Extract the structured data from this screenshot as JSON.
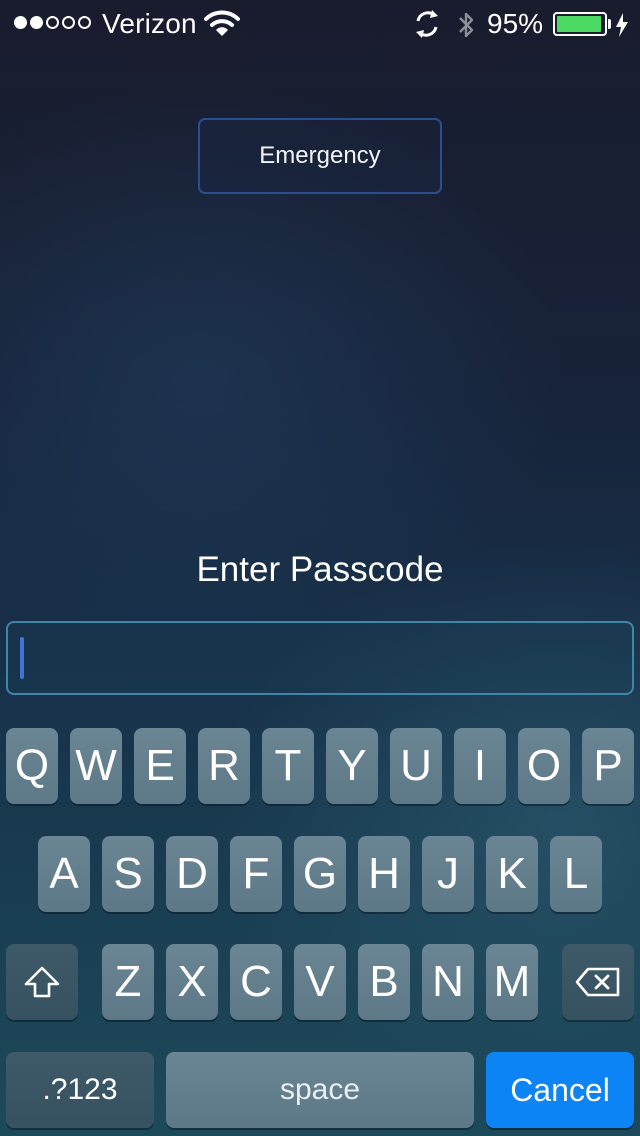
{
  "status_bar": {
    "carrier": "Verizon",
    "signal_strength_of_5": 2,
    "battery_percent_text": "95%",
    "battery_level": 0.95,
    "battery_color": "#4cd964",
    "icons": [
      "wifi-icon",
      "sync-icon",
      "bluetooth-icon",
      "battery-icon",
      "charging-bolt-icon"
    ]
  },
  "emergency_label": "Emergency",
  "prompt": "Enter Passcode",
  "passcode_field": {
    "value": "",
    "cursor_color": "#3d74d6"
  },
  "keyboard": {
    "row1": [
      "Q",
      "W",
      "E",
      "R",
      "T",
      "Y",
      "U",
      "I",
      "O",
      "P"
    ],
    "row2": [
      "A",
      "S",
      "D",
      "F",
      "G",
      "H",
      "J",
      "K",
      "L"
    ],
    "row3": [
      "Z",
      "X",
      "C",
      "V",
      "B",
      "N",
      "M"
    ],
    "shift_icon": "shift-arrow-icon",
    "delete_icon": "backspace-icon",
    "numbers_label": ".?123",
    "space_label": "space",
    "cancel_label": "Cancel",
    "cancel_color": "#0c84f5"
  }
}
